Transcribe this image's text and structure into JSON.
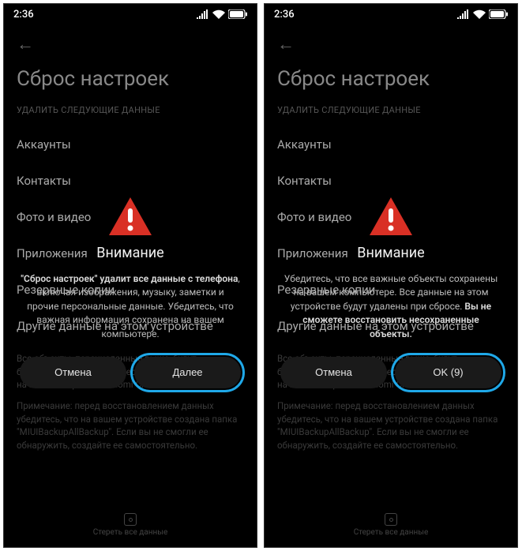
{
  "status": {
    "time": "2:36"
  },
  "page": {
    "title": "Сброс настроек",
    "section_label": "УДАЛИТЬ СЛЕДУЮЩИЕ ДАННЫЕ",
    "items": [
      "Аккаунты",
      "Контакты",
      "Фото и видео",
      "Приложения",
      "Резервные копии",
      "Другие данные на этом устройстве"
    ],
    "footer1": "Все объекты, перечисленные выше, будут безвозвратно удалены. Перенесите важные данные на компьютер или в Xiaomi Cloud.",
    "footer2": "Примечание: перед восстановлением данных убедитесь, что на вашем устройстве создана папка \"MIUIBackupAllBackup\". Если вы не смогли ее обнаружить, создайте ее самостоятельно.",
    "bottom_label": "Стереть все данные"
  },
  "dialog1": {
    "title": "Внимание",
    "body_bold": "\"Сброс настроек\" удалит все данные с телефона",
    "body_rest": ", включая изображения, музыку, заметки и прочие персональные данные. Убедитесь, что важная информация сохранена на вашем компьютере.",
    "cancel": "Отмена",
    "confirm": "Далее"
  },
  "dialog2": {
    "title": "Внимание",
    "body_start": "Убедитесь, что все важные объекты сохранены на вашем компьютере. Все данные на этом устройстве будут удалены при сбросе. ",
    "body_bold": "Вы не сможете восстановить несохраненные объекты.",
    "cancel": "Отмена",
    "confirm": "OK (9)"
  }
}
